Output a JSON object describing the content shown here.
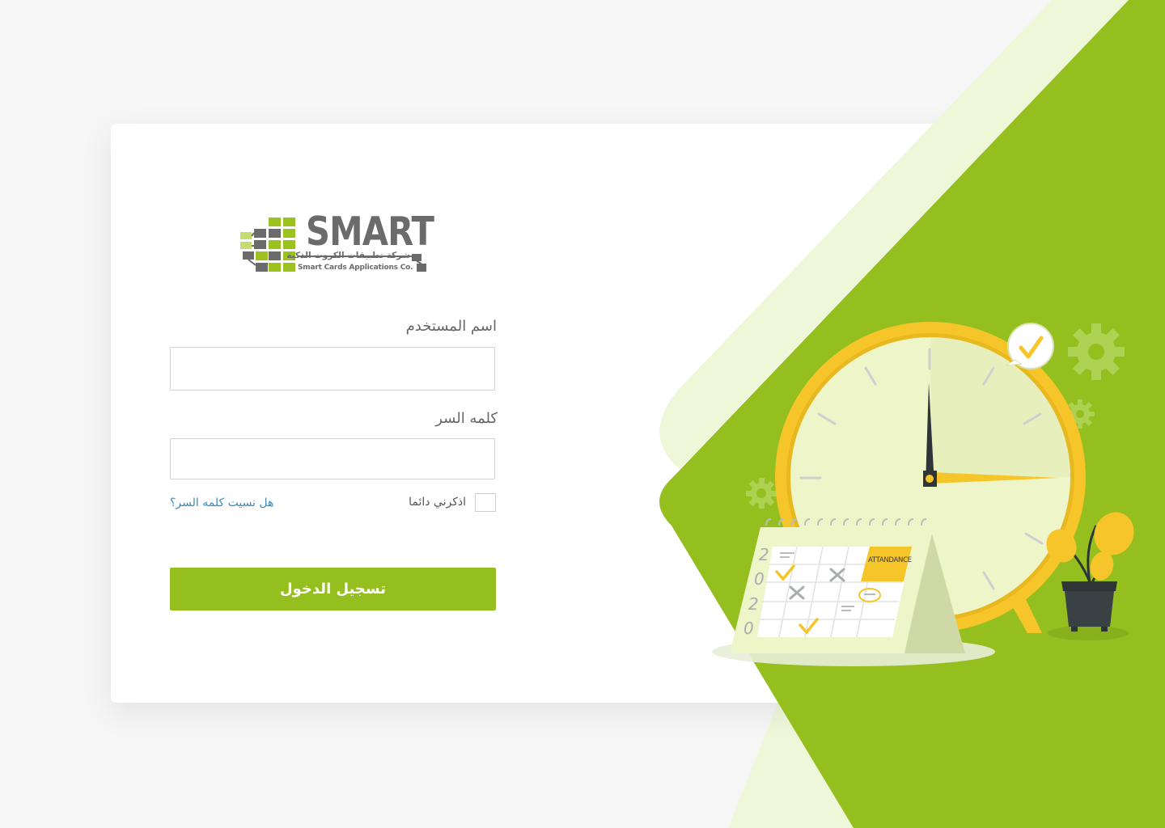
{
  "brand": {
    "name": "SMART",
    "name_ar": "شركة تطبيقات الكروت الذكية",
    "name_en": "Smart Cards Applications Co."
  },
  "form": {
    "username_label": "اسم المستخدم",
    "username_value": "",
    "password_label": "كلمه السر",
    "password_value": "",
    "remember_label": "اذكرني دائما",
    "remember_checked": false,
    "forgot_link": "هل نسيت كلمه السر؟",
    "submit_label": "تسجيل الدخول"
  },
  "illustration": {
    "calendar_year_digits": [
      "2",
      "0",
      "2",
      "0"
    ],
    "sticky_note": "ATTANDANCE"
  },
  "colors": {
    "accent": "#94bf1f",
    "accent_light": "#eef7d8",
    "clock_yellow": "#f6c52a",
    "logo_green": "#9bc21f",
    "logo_gray": "#6b6b6b",
    "link": "#3d8bb5"
  }
}
